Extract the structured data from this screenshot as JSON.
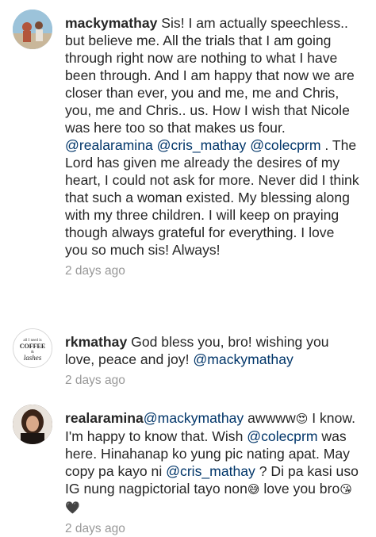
{
  "comments": [
    {
      "username": "mackymathay",
      "segments": [
        {
          "t": "text",
          "v": " Sis! I am actually speechless.. but believe me. All the trials that I am going through right now are nothing to what I have been through. And I am happy that now we are closer than ever, you and me, me and Chris, you, me and Chris.. us. How I wish that Nicole was here too so that makes us four. "
        },
        {
          "t": "mention",
          "v": "@realaramina"
        },
        {
          "t": "text",
          "v": " "
        },
        {
          "t": "mention",
          "v": "@cris_mathay"
        },
        {
          "t": "text",
          "v": " "
        },
        {
          "t": "mention",
          "v": "@colecprm"
        },
        {
          "t": "text",
          "v": " . The Lord has given me already the desires of my heart, I could not ask for more. Never did I think that such a woman existed. My blessing along with my three children. I will keep on praying though always grateful for everything. I love you so much sis! Always!"
        }
      ],
      "time": "2 days ago"
    },
    {
      "username": "rkmathay",
      "avatar_text": [
        "all I need is",
        "COFFEE",
        "&",
        "lashes"
      ],
      "segments": [
        {
          "t": "text",
          "v": " God bless you, bro! wishing you love, peace and joy!  "
        },
        {
          "t": "mention",
          "v": "@mackymathay"
        }
      ],
      "time": "2 days ago"
    },
    {
      "username": "realaramina",
      "segments": [
        {
          "t": "mention",
          "v": "@mackymathay"
        },
        {
          "t": "text",
          "v": " awwww"
        },
        {
          "t": "emoji",
          "v": "😍"
        },
        {
          "t": "text",
          "v": " I know. I'm happy to know that. Wish "
        },
        {
          "t": "mention",
          "v": "@colecprm"
        },
        {
          "t": "text",
          "v": " was here. Hinahanap ko yung pic nating apat. May copy pa kayo ni "
        },
        {
          "t": "mention",
          "v": "@cris_mathay"
        },
        {
          "t": "text",
          "v": " ? Di pa kasi uso IG nung nagpictorial tayo non"
        },
        {
          "t": "emoji",
          "v": "😅"
        },
        {
          "t": "text",
          "v": " love you bro"
        },
        {
          "t": "emoji",
          "v": "😘🖤"
        }
      ],
      "time": "2 days ago"
    }
  ],
  "colors": {
    "mention": "#003569",
    "username": "#262626",
    "timestamp": "#999999"
  }
}
